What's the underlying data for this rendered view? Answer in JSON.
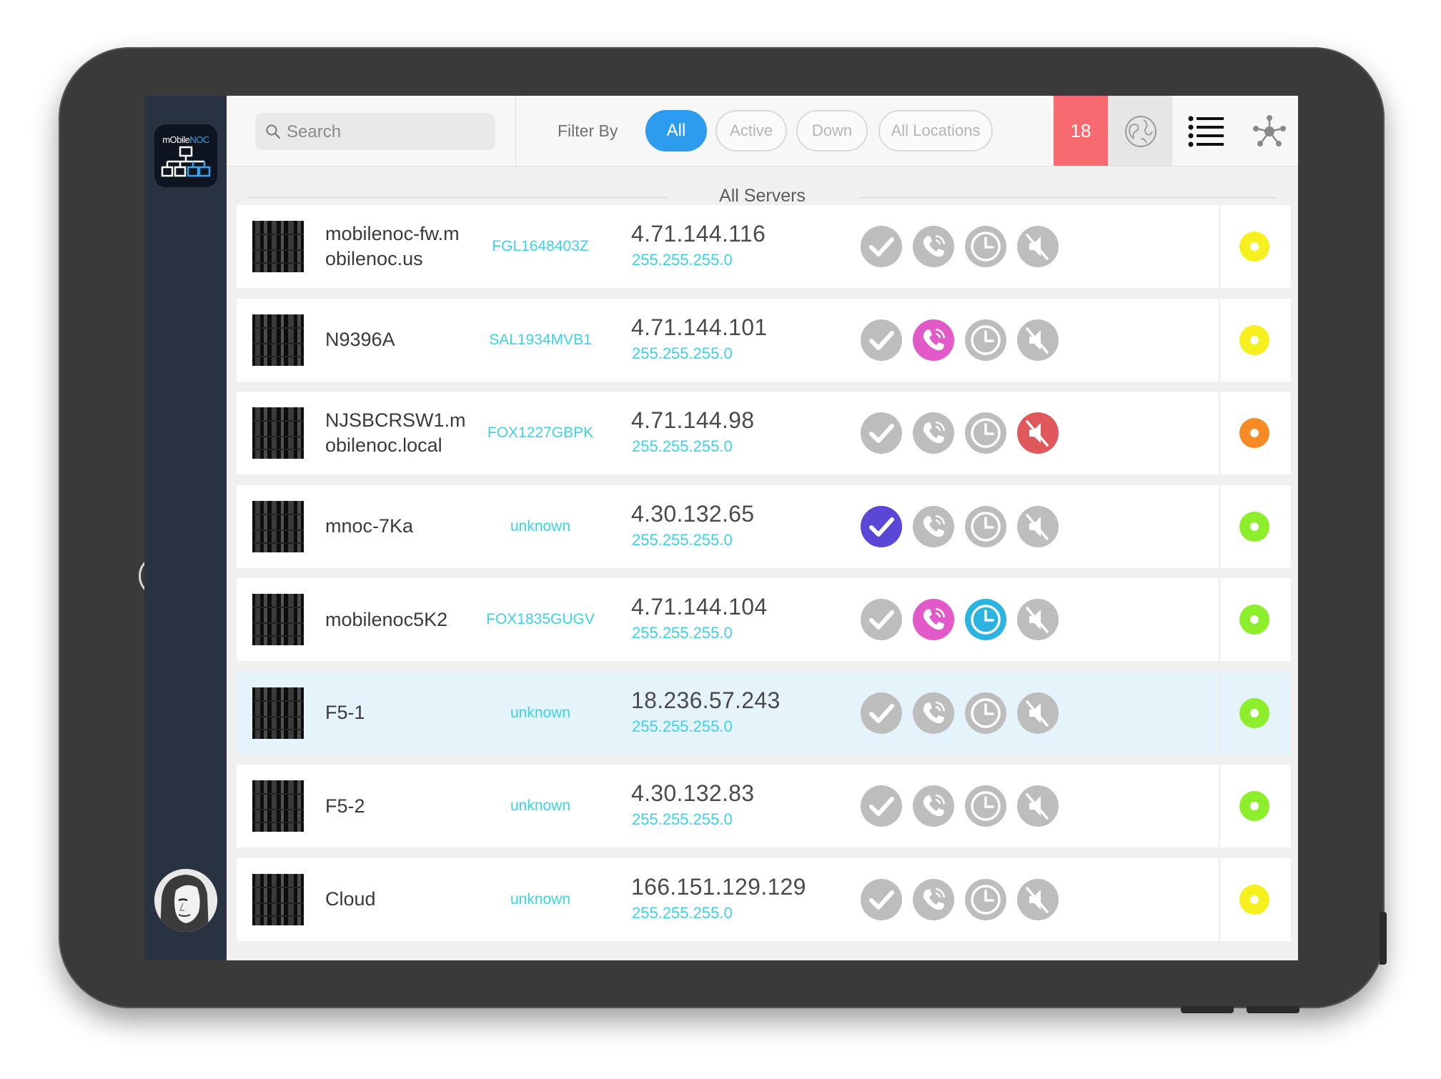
{
  "app": {
    "logo": "mObileNOC",
    "accent": "#2d9cee",
    "serial_color": "#3cd2e6"
  },
  "search": {
    "placeholder": "Search",
    "value": ""
  },
  "filter": {
    "label": "Filter By",
    "options": [
      "All",
      "Active",
      "Down",
      "All Locations"
    ],
    "selected": "All"
  },
  "toolbar": {
    "alert_count": "18",
    "buttons": [
      "globe-icon",
      "list-icon",
      "network-icon"
    ]
  },
  "section_title": "All Servers",
  "servers": [
    {
      "name": "mobilenoc-fw.mobilenoc.us",
      "serial": "FGL1648403Z",
      "ip": "4.71.144.116",
      "mask": "255.255.255.0",
      "ack": false,
      "call": false,
      "schedule": false,
      "mute": false,
      "status": "#f7f01f",
      "highlight": false
    },
    {
      "name": "N9396A",
      "serial": "SAL1934MVB1",
      "ip": "4.71.144.101",
      "mask": "255.255.255.0",
      "ack": false,
      "call": true,
      "schedule": false,
      "mute": false,
      "status": "#f7f01f",
      "highlight": false
    },
    {
      "name": "NJSBCRSW1.mobilenoc.local",
      "serial": "FOX1227GBPK",
      "ip": "4.71.144.98",
      "mask": "255.255.255.0",
      "ack": false,
      "call": false,
      "schedule": false,
      "mute": true,
      "status": "#f68b25",
      "highlight": false
    },
    {
      "name": "mnoc-7Ka",
      "serial": "unknown",
      "ip": "4.30.132.65",
      "mask": "255.255.255.0",
      "ack": true,
      "call": false,
      "schedule": false,
      "mute": false,
      "status": "#8def2c",
      "highlight": false
    },
    {
      "name": "mobilenoc5K2",
      "serial": "FOX1835GUGV",
      "ip": "4.71.144.104",
      "mask": "255.255.255.0",
      "ack": false,
      "call": true,
      "schedule": true,
      "mute": false,
      "status": "#8def2c",
      "highlight": false
    },
    {
      "name": "F5-1",
      "serial": "unknown",
      "ip": "18.236.57.243",
      "mask": "255.255.255.0",
      "ack": false,
      "call": false,
      "schedule": false,
      "mute": false,
      "status": "#8def2c",
      "highlight": true
    },
    {
      "name": "F5-2",
      "serial": "unknown",
      "ip": "4.30.132.83",
      "mask": "255.255.255.0",
      "ack": false,
      "call": false,
      "schedule": false,
      "mute": false,
      "status": "#8def2c",
      "highlight": false
    },
    {
      "name": "Cloud",
      "serial": "unknown",
      "ip": "166.151.129.129",
      "mask": "255.255.255.0",
      "ack": false,
      "call": false,
      "schedule": false,
      "mute": false,
      "status": "#f7f01f",
      "highlight": false
    }
  ],
  "icon_colors": {
    "inactive": "#bdbdbd",
    "ack": "#5a47d6",
    "call": "#e259c9",
    "schedule": "#2bb4e0",
    "mute": "#e0585c"
  }
}
